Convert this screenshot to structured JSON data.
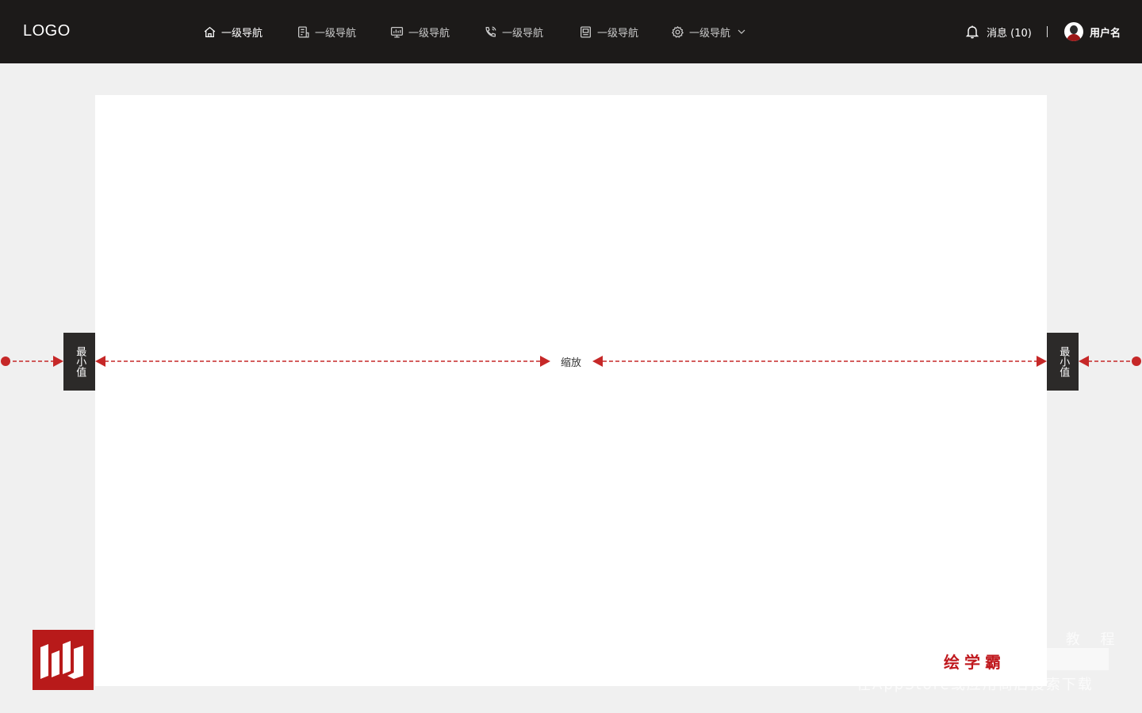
{
  "header": {
    "logo": "LOGO",
    "nav": [
      {
        "label": "一级导航",
        "icon": "home-icon",
        "active": true
      },
      {
        "label": "一级导航",
        "icon": "document-icon"
      },
      {
        "label": "一级导航",
        "icon": "monitor-icon"
      },
      {
        "label": "一级导航",
        "icon": "phone-call-icon"
      },
      {
        "label": "一级导航",
        "icon": "image-doc-icon"
      },
      {
        "label": "一级导航",
        "icon": "gear-icon",
        "has_dropdown": true
      }
    ],
    "messages_label": "消息 (10)",
    "username": "用户名"
  },
  "canvas": {
    "min_left": "最小值",
    "min_right": "最小值",
    "zoom_label": "缩放",
    "accent_color": "#c62828"
  },
  "watermark": {
    "brand": "绘学霸",
    "faint_right_top": "品 教 程",
    "faint_right_bottom": "在AppStore或应用商店搜索下载"
  }
}
